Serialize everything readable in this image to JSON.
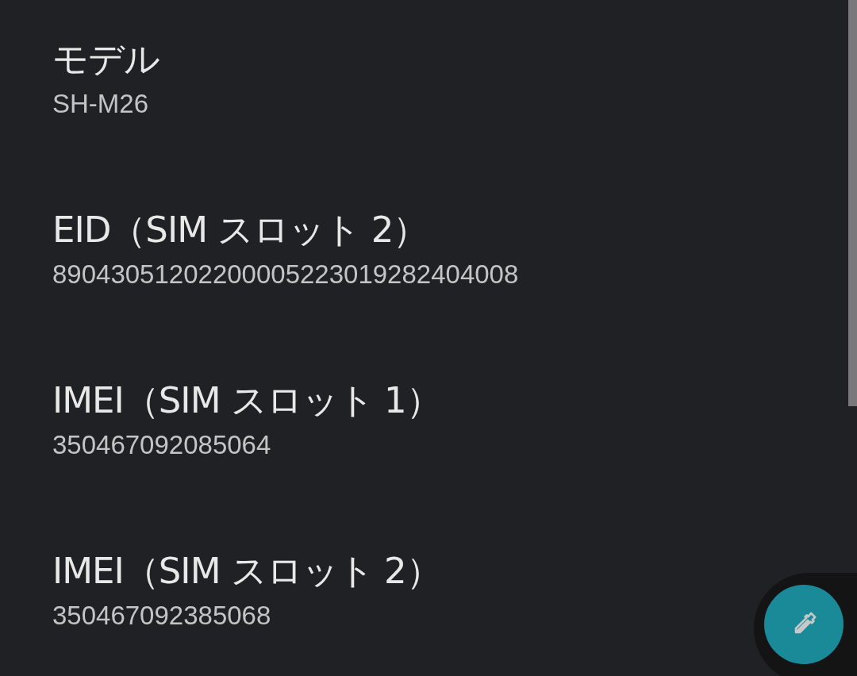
{
  "items": [
    {
      "title": "モデル",
      "value": "SH-M26"
    },
    {
      "title": "EID（SIM スロット 2）",
      "value": "89043051202200005223019282404008"
    },
    {
      "title": "IMEI（SIM スロット 1）",
      "value": "350467092085064"
    },
    {
      "title": "IMEI（SIM スロット 2）",
      "value": "350467092385068"
    }
  ]
}
